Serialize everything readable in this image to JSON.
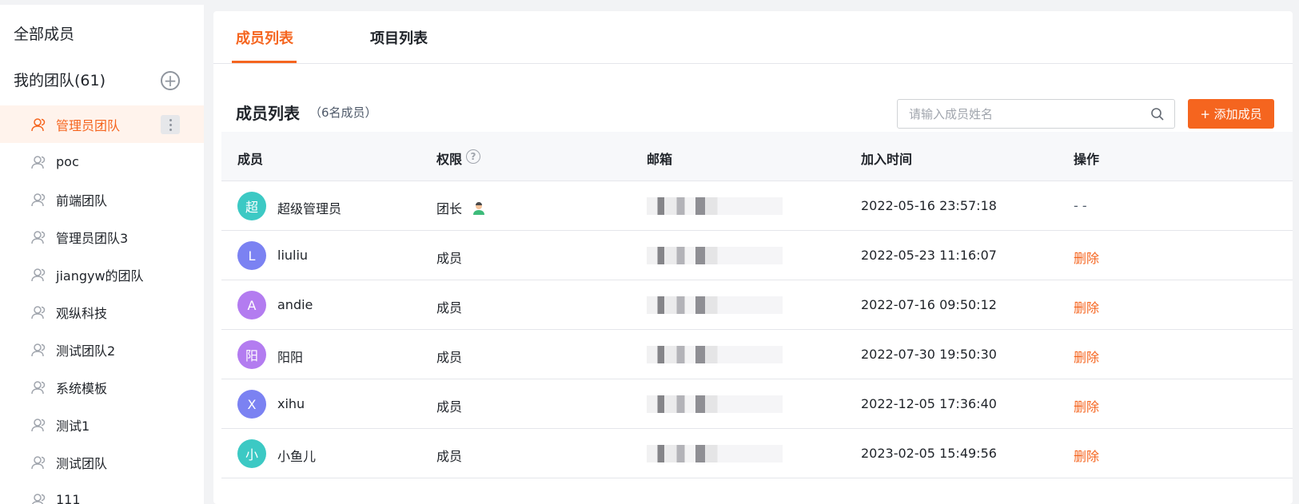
{
  "sidebar": {
    "all_members": "全部成员",
    "my_team": "我的团队(61)",
    "teams": [
      {
        "label": "管理员团队"
      },
      {
        "label": "poc"
      },
      {
        "label": "前端团队"
      },
      {
        "label": "管理员团队3"
      },
      {
        "label": "jiangyw的团队"
      },
      {
        "label": "观纵科技"
      },
      {
        "label": "测试团队2"
      },
      {
        "label": "系统模板"
      },
      {
        "label": "测试1"
      },
      {
        "label": "测试团队"
      },
      {
        "label": "111"
      }
    ]
  },
  "tabs": [
    {
      "label": "成员列表"
    },
    {
      "label": "项目列表"
    }
  ],
  "list": {
    "title": "成员列表",
    "count": "（6名成员）",
    "search_placeholder": "请输入成员姓名",
    "add_button": "+ 添加成员"
  },
  "table": {
    "headers": [
      "成员",
      "权限",
      "邮箱",
      "加入时间",
      "操作"
    ],
    "rows": [
      {
        "initial": "超",
        "name": "超级管理员",
        "role": "团长",
        "joined": "2022-05-16 23:57:18",
        "action": "- -",
        "avatar_color": "#3cc9c4"
      },
      {
        "initial": "L",
        "name": "liuliu",
        "role": "成员",
        "joined": "2022-05-23 11:16:07",
        "action": "删除",
        "avatar_color": "#7b82f2"
      },
      {
        "initial": "A",
        "name": "andie",
        "role": "成员",
        "joined": "2022-07-16 09:50:12",
        "action": "删除",
        "avatar_color": "#b37cf0"
      },
      {
        "initial": "阳",
        "name": "阳阳",
        "role": "成员",
        "joined": "2022-07-30 19:50:30",
        "action": "删除",
        "avatar_color": "#b37cf0"
      },
      {
        "initial": "X",
        "name": "xihu",
        "role": "成员",
        "joined": "2022-12-05 17:36:40",
        "action": "删除",
        "avatar_color": "#7b82f2"
      },
      {
        "initial": "小",
        "name": "小鱼儿",
        "role": "成员",
        "joined": "2023-02-05 15:49:56",
        "action": "删除",
        "avatar_color": "#3cc9c4"
      }
    ]
  },
  "colors": {
    "accent": "#f5651f",
    "active_bg": "#fff3ec"
  }
}
